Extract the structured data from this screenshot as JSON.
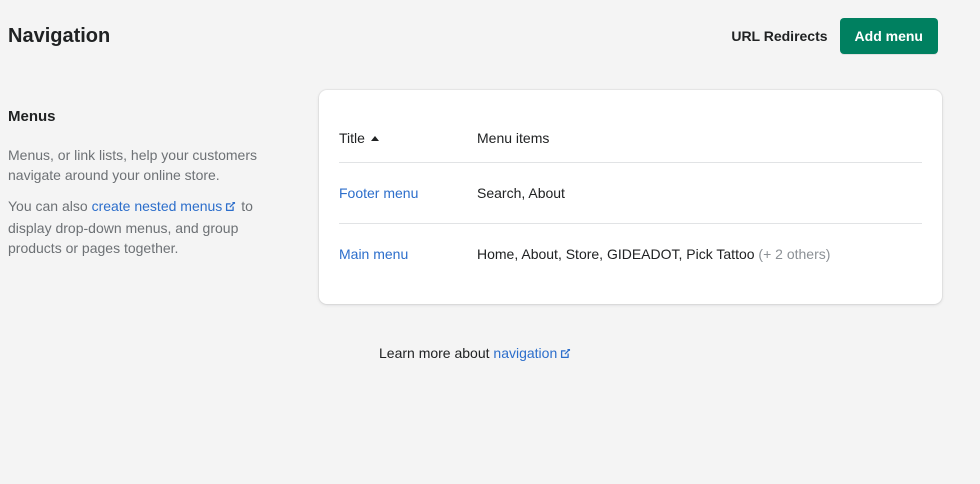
{
  "header": {
    "title": "Navigation",
    "url_redirects_label": "URL Redirects",
    "add_menu_label": "Add menu"
  },
  "aside": {
    "heading": "Menus",
    "paragraph1": "Menus, or link lists, help your customers navigate around your online store.",
    "paragraph2_prefix": "You can also ",
    "paragraph2_link": "create nested menus",
    "paragraph2_suffix": " to display drop-down menus, and group products or pages together."
  },
  "table": {
    "col_title": "Title",
    "col_items": "Menu items",
    "rows": [
      {
        "title": "Footer menu",
        "items": "Search, About",
        "extra": ""
      },
      {
        "title": "Main menu",
        "items": "Home, About, Store, GIDEADOT, Pick Tattoo",
        "extra": "(+ 2 others)"
      }
    ]
  },
  "footer_help": {
    "prefix": "Learn more about ",
    "link": "navigation"
  },
  "colors": {
    "primary": "#008060",
    "link": "#2c6ecb",
    "background": "#f4f4f4"
  },
  "icons": [
    "external-link-icon",
    "sort-ascending-icon"
  ]
}
